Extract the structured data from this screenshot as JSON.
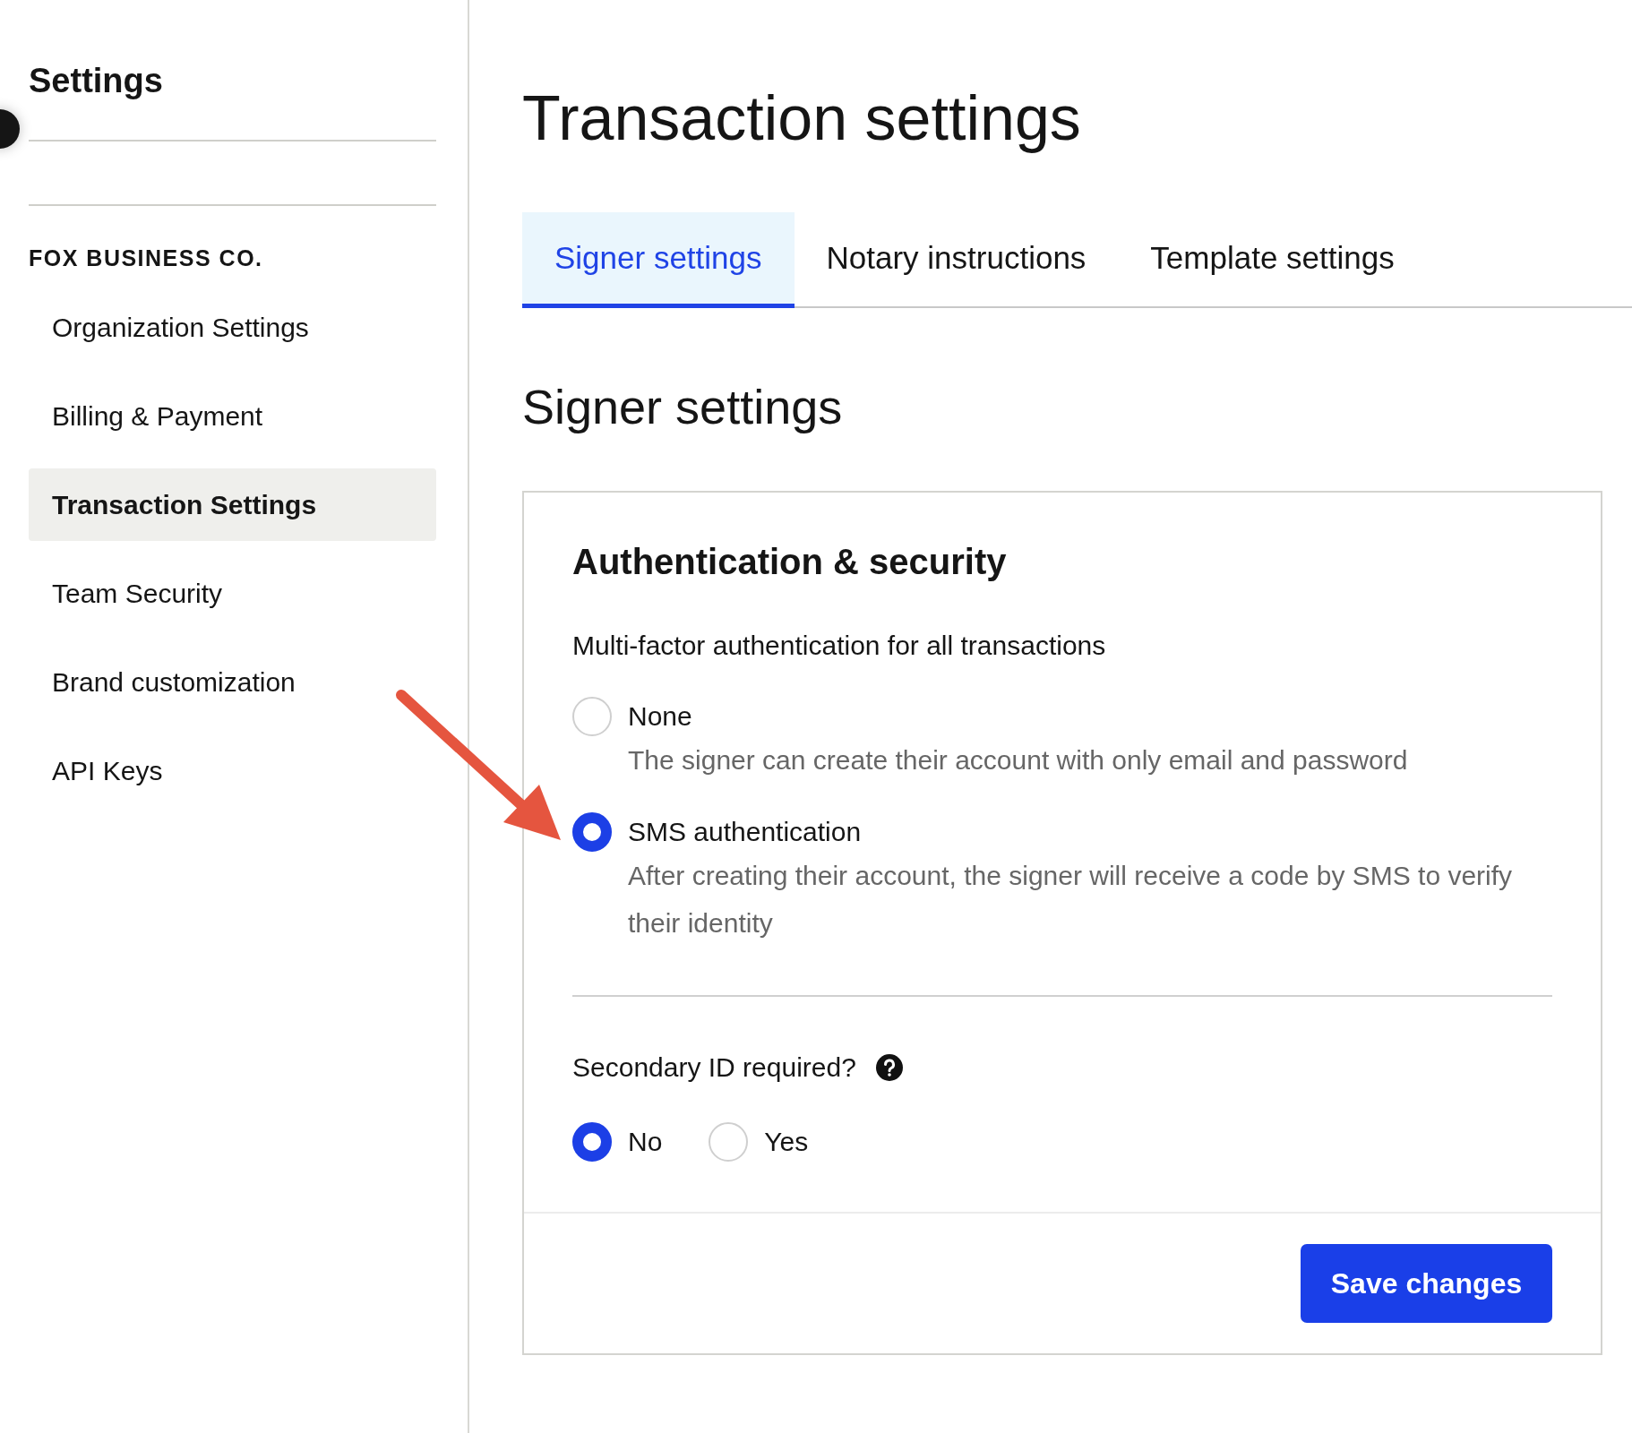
{
  "sidebar": {
    "title": "Settings",
    "org_name": "FOX BUSINESS CO.",
    "items": [
      {
        "label": "Organization Settings",
        "selected": false
      },
      {
        "label": "Billing & Payment",
        "selected": false
      },
      {
        "label": "Transaction Settings",
        "selected": true
      },
      {
        "label": "Team Security",
        "selected": false
      },
      {
        "label": "Brand customization",
        "selected": false
      },
      {
        "label": "API Keys",
        "selected": false
      }
    ]
  },
  "main": {
    "title": "Transaction settings",
    "tabs": [
      {
        "label": "Signer settings",
        "selected": true
      },
      {
        "label": "Notary instructions",
        "selected": false
      },
      {
        "label": "Template settings",
        "selected": false
      }
    ],
    "section_title": "Signer settings",
    "card": {
      "title": "Authentication & security",
      "mfa": {
        "label": "Multi-factor authentication for all transactions",
        "options": [
          {
            "label": "None",
            "description": "The signer can create their account with only email and password",
            "selected": false
          },
          {
            "label": "SMS authentication",
            "description": "After creating their account, the signer will receive a code by SMS to verify their identity",
            "selected": true
          }
        ]
      },
      "secondary_id": {
        "label": "Secondary ID required?",
        "options": [
          {
            "label": "No",
            "selected": true
          },
          {
            "label": "Yes",
            "selected": false
          }
        ]
      },
      "save_button": "Save changes"
    }
  }
}
